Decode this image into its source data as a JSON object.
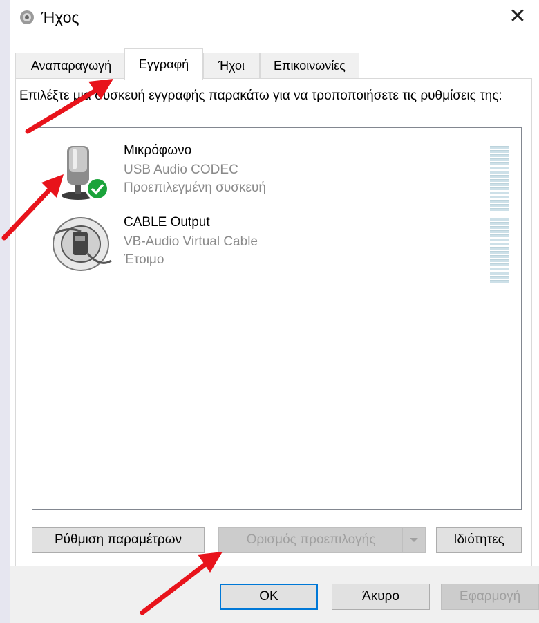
{
  "window": {
    "title": "Ήχος",
    "close_glyph": "✕",
    "icon": "speaker-icon"
  },
  "tabs": [
    {
      "label": "Αναπαραγωγή",
      "active": false
    },
    {
      "label": "Εγγραφή",
      "active": true
    },
    {
      "label": "Ήχοι",
      "active": false
    },
    {
      "label": "Επικοινωνίες",
      "active": false
    }
  ],
  "instructions": "Επιλέξτε μια συσκευή εγγραφής παρακάτω για να τροποποιήσετε τις ρυθμίσεις της:",
  "devices": [
    {
      "name": "Μικρόφωνο",
      "driver": "USB Audio CODEC",
      "status": "Προεπιλεγμένη συσκευή",
      "icon": "microphone-icon",
      "default": true
    },
    {
      "name": "CABLE Output",
      "driver": "VB-Audio Virtual Cable",
      "status": "Έτοιμο",
      "icon": "virtual-cable-icon",
      "default": false
    }
  ],
  "buttons": {
    "configure": "Ρύθμιση παραμέτρων",
    "set_default": "Ορισμός προεπιλογής",
    "properties": "Ιδιότητες",
    "ok": "OK",
    "cancel": "Άκυρο",
    "apply": "Εφαρμογή"
  },
  "colors": {
    "annotation_arrow": "#e8131b",
    "default_check": "#1aa33a",
    "focus_border": "#0078d7"
  }
}
